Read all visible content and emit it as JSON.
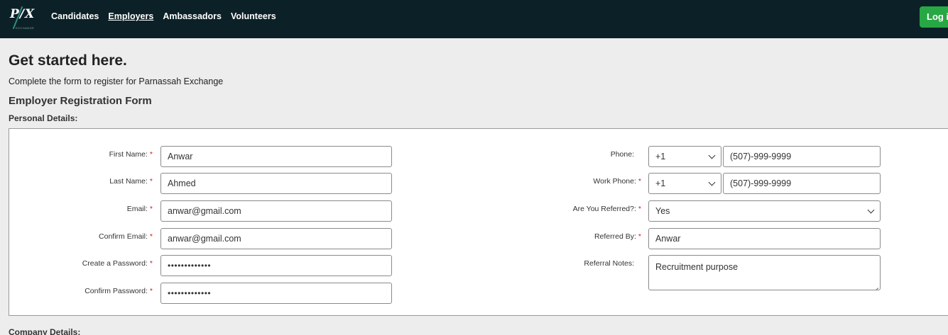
{
  "nav": {
    "logo_text": "P/X",
    "logo_sub": "EXCHANGE",
    "items": [
      {
        "label": "Candidates",
        "active": false
      },
      {
        "label": "Employers",
        "active": true
      },
      {
        "label": "Ambassadors",
        "active": false
      },
      {
        "label": "Volunteers",
        "active": false
      }
    ],
    "login_label": "Log in"
  },
  "header": {
    "title": "Get started here.",
    "subtitle": "Complete the form to register for Parnassah Exchange",
    "form_title": "Employer Registration Form",
    "personal_section": "Personal Details:",
    "company_section": "Company Details:"
  },
  "left_fields": {
    "first_name": {
      "label": "First Name:",
      "required": "*",
      "value": "Anwar"
    },
    "last_name": {
      "label": "Last Name:",
      "required": "*",
      "value": "Ahmed"
    },
    "email": {
      "label": "Email:",
      "required": "*",
      "value": "anwar@gmail.com"
    },
    "confirm_email": {
      "label": "Confirm Email:",
      "required": "*",
      "value": "anwar@gmail.com"
    },
    "password": {
      "label": "Create a Password:",
      "required": "*",
      "value": "•••••••••••••"
    },
    "confirm_password": {
      "label": "Confirm Password:",
      "required": "*",
      "value": "•••••••••••••"
    }
  },
  "right_fields": {
    "phone": {
      "label": "Phone:",
      "country_code": "+1",
      "value": "(507)-999-9999"
    },
    "work_phone": {
      "label": "Work Phone:",
      "required": "*",
      "country_code": "+1",
      "value": "(507)-999-9999"
    },
    "referred": {
      "label": "Are You Referred?:",
      "required": "*",
      "value": "Yes"
    },
    "referred_by": {
      "label": "Referred By:",
      "required": "*",
      "value": "Anwar"
    },
    "referral_notes": {
      "label": "Referral Notes:",
      "value": "Recruitment purpose"
    }
  },
  "colors": {
    "nav_bg": "#0c2127",
    "login_bg": "#28a745",
    "required": "#d12020",
    "page_bg": "#ededed"
  }
}
